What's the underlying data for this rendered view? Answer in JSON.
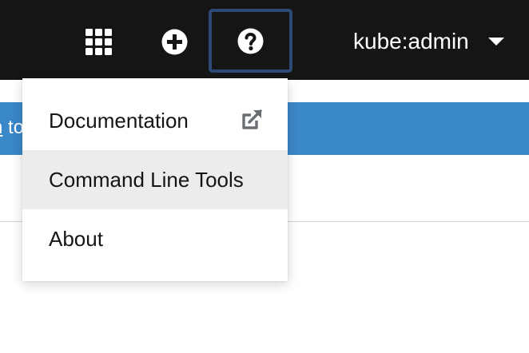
{
  "masthead": {
    "user_name": "kube:admin",
    "icons": [
      "apps-grid-icon",
      "plus-circle-icon",
      "question-circle-icon",
      "caret-down-icon"
    ]
  },
  "banner": {
    "partial_text_underlined": "n",
    "partial_text": " to"
  },
  "help_menu": {
    "items": [
      {
        "label": "Documentation",
        "icon": "external-link-icon"
      },
      {
        "label": "Command Line Tools"
      },
      {
        "label": "About"
      }
    ]
  },
  "colors": {
    "masthead": "#151515",
    "banner": "#3a87c9",
    "focus_border": "#2b4a76",
    "menu_hover": "#ececec"
  }
}
